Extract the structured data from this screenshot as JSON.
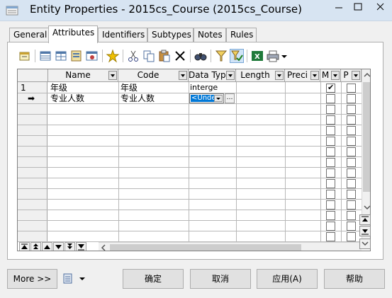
{
  "window": {
    "title": "Entity Properties - 2015cs_Course (2015cs_Course)",
    "controls": [
      "minimize",
      "maximize",
      "close"
    ]
  },
  "tabs": [
    {
      "label": "General",
      "active": false
    },
    {
      "label": "Attributes",
      "active": true
    },
    {
      "label": "Identifiers",
      "active": false
    },
    {
      "label": "Subtypes",
      "active": false
    },
    {
      "label": "Notes",
      "active": false
    },
    {
      "label": "Rules",
      "active": false
    }
  ],
  "toolbar": {
    "icons": [
      "properties-icon",
      "insert-row-icon",
      "add-row-icon",
      "add-attribute-icon",
      "reuse-attribute-icon",
      "new-icon",
      "cut-icon",
      "copy-icon",
      "paste-icon",
      "delete-icon",
      "find-icon",
      "filter-icon",
      "customize-columns-icon",
      "export-excel-icon",
      "print-icon",
      "dropdown-icon"
    ]
  },
  "grid": {
    "columns": [
      {
        "label": "Name"
      },
      {
        "label": "Code"
      },
      {
        "label": "Data Typ"
      },
      {
        "label": "Length"
      },
      {
        "label": "Preci"
      },
      {
        "label": "M"
      },
      {
        "label": "P"
      }
    ],
    "rows": [
      {
        "marker": "1",
        "name": "年级",
        "code": "年级",
        "datatype": "interge",
        "mandatory": true,
        "primary": false
      },
      {
        "marker": "➡",
        "name": "专业人数",
        "code": "专业人数",
        "datatype": "<Unde",
        "mandatory": false,
        "primary": false,
        "editing": true
      }
    ],
    "nav_buttons": [
      "move-top",
      "move-up-page",
      "move-up",
      "move-down",
      "move-down-page",
      "move-bottom"
    ]
  },
  "bottom": {
    "more": "More >>",
    "ok": "确定",
    "cancel": "取消",
    "apply": "应用(A)",
    "help": "帮助"
  }
}
